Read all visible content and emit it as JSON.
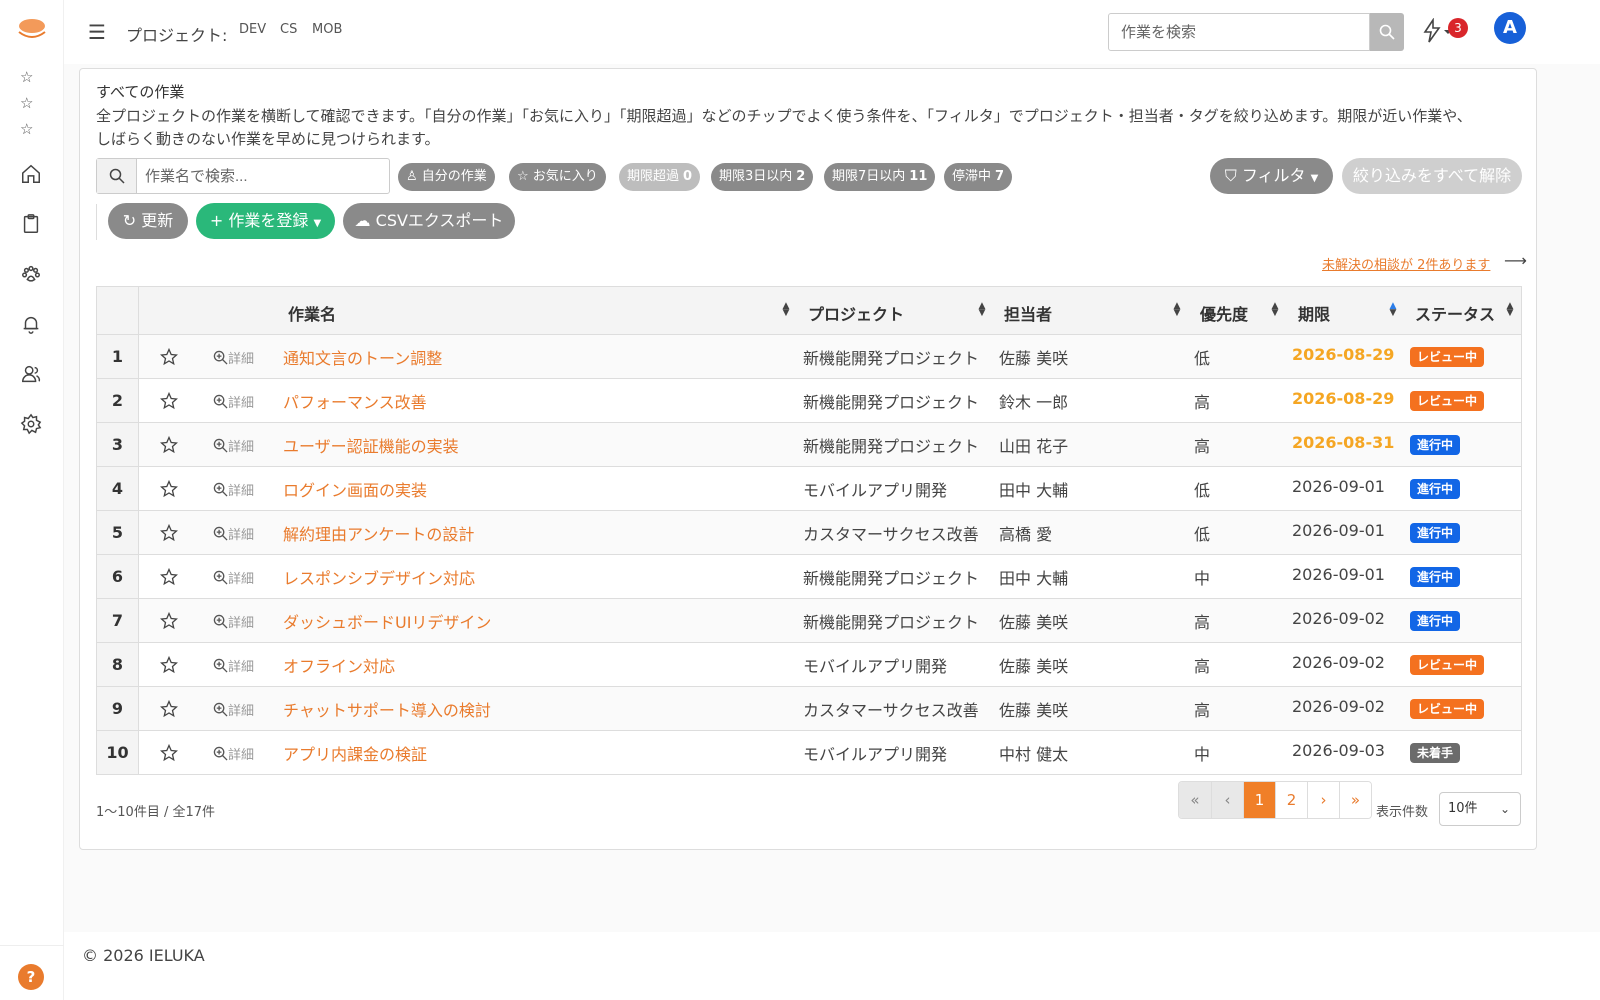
{
  "topbar": {
    "project_label": "プロジェクト:",
    "projects": [
      "DEV",
      "CS",
      "MOB"
    ],
    "search_placeholder": "作業を検索",
    "notif_count": "3",
    "avatar_initial": "A"
  },
  "rail": {
    "help": "?"
  },
  "page": {
    "title": "すべての作業",
    "description": "全プロジェクトの作業を横断して確認できます。「自分の作業」「お気に入り」「期限超過」などのチップでよく使う条件を、「フィルタ」でプロジェクト・担当者・タグを絞り込めます。期限が近い作業や、しばらく動きのない作業を早めに見つけられます。",
    "search_placeholder": "作業名で検索...",
    "chips": {
      "mine": "自分の作業",
      "favorites": "お気に入り",
      "overdue": "期限超過",
      "overdue_count": "0",
      "due3": "期限3日以内",
      "due3_count": "2",
      "due7": "期限7日以内",
      "due7_count": "11",
      "stalled": "停滞中",
      "stalled_count": "7"
    },
    "filter_button": "フィルタ",
    "clear_button": "絞り込みをすべて解除",
    "refresh_button": "更新",
    "add_button": "作業を登録",
    "csv_button": "CSVエクスポート",
    "consult_link": "未解決の相談が 2件あります"
  },
  "table": {
    "headers": {
      "name": "作業名",
      "project": "プロジェクト",
      "assignee": "担当者",
      "priority": "優先度",
      "due": "期限",
      "status": "ステータス"
    },
    "detail_label": "詳細",
    "rows": [
      {
        "num": "1",
        "name": "通知文言のトーン調整",
        "project": "新機能開発プロジェクト",
        "assignee": "佐藤 美咲",
        "priority": "低",
        "due": "2026-08-29",
        "status": "レビュー中"
      },
      {
        "num": "2",
        "name": "パフォーマンス改善",
        "project": "新機能開発プロジェクト",
        "assignee": "鈴木 一郎",
        "priority": "高",
        "due": "2026-08-29",
        "status": "レビュー中"
      },
      {
        "num": "3",
        "name": "ユーザー認証機能の実装",
        "project": "新機能開発プロジェクト",
        "assignee": "山田 花子",
        "priority": "高",
        "due": "2026-08-31",
        "status": "進行中"
      },
      {
        "num": "4",
        "name": "ログイン画面の実装",
        "project": "モバイルアプリ開発",
        "assignee": "田中 大輔",
        "priority": "低",
        "due": "2026-09-01",
        "status": "進行中"
      },
      {
        "num": "5",
        "name": "解約理由アンケートの設計",
        "project": "カスタマーサクセス改善",
        "assignee": "高橋 愛",
        "priority": "低",
        "due": "2026-09-01",
        "status": "進行中"
      },
      {
        "num": "6",
        "name": "レスポンシブデザイン対応",
        "project": "新機能開発プロジェクト",
        "assignee": "田中 大輔",
        "priority": "中",
        "due": "2026-09-01",
        "status": "進行中"
      },
      {
        "num": "7",
        "name": "ダッシュボードUIリデザイン",
        "project": "新機能開発プロジェクト",
        "assignee": "佐藤 美咲",
        "priority": "高",
        "due": "2026-09-02",
        "status": "進行中"
      },
      {
        "num": "8",
        "name": "オフライン対応",
        "project": "モバイルアプリ開発",
        "assignee": "佐藤 美咲",
        "priority": "高",
        "due": "2026-09-02",
        "status": "レビュー中"
      },
      {
        "num": "9",
        "name": "チャットサポート導入の検討",
        "project": "カスタマーサクセス改善",
        "assignee": "佐藤 美咲",
        "priority": "高",
        "due": "2026-09-02",
        "status": "レビュー中"
      },
      {
        "num": "10",
        "name": "アプリ内課金の検証",
        "project": "モバイルアプリ開発",
        "assignee": "中村 健太",
        "priority": "中",
        "due": "2026-09-03",
        "status": "未着手"
      }
    ]
  },
  "pagination": {
    "count_text": "1〜10件目 / 全17件",
    "first": "«",
    "prev": "‹",
    "page1": "1",
    "page2": "2",
    "next": "›",
    "last": "»",
    "per_page_label": "表示件数",
    "per_page_value": "10件"
  },
  "footer": {
    "copyright": "© 2026 IELUKA"
  },
  "colors": {
    "accent": "#e97b2d",
    "warn_due": "#f5a623",
    "status_review": "#f4711f",
    "status_progress": "#1266e6",
    "status_todo": "#6b6b6b",
    "primary_green": "#2ab87a"
  }
}
